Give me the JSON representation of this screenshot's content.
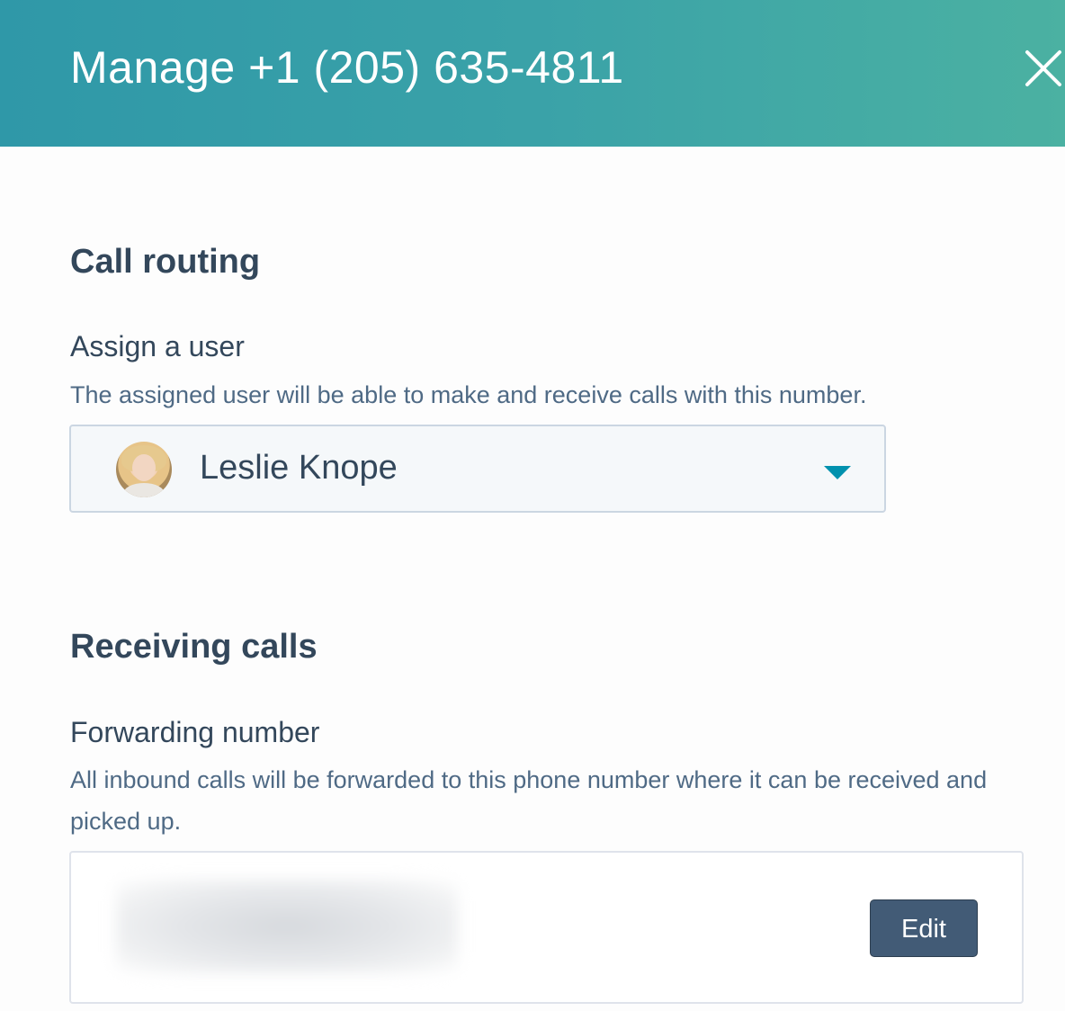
{
  "header": {
    "title": "Manage +1 (205) 635-4811",
    "close_icon": "close-icon"
  },
  "call_routing": {
    "heading": "Call routing",
    "assign_user": {
      "label": "Assign a user",
      "help": "The assigned user will be able to make and receive calls with this number.",
      "selected_user": "Leslie Knope",
      "avatar_icon": "user-avatar",
      "dropdown_icon": "caret-down-icon"
    }
  },
  "receiving_calls": {
    "heading": "Receiving calls",
    "forwarding_number": {
      "label": "Forwarding number",
      "help": "All inbound calls will be forwarded to this phone number where it can be received and picked up.",
      "edit_label": "Edit"
    }
  },
  "colors": {
    "header_start": "#2f98a8",
    "header_end": "#4bb1a2",
    "text_primary": "#33475b",
    "accent": "#0091ae",
    "button_bg": "#425b76"
  }
}
